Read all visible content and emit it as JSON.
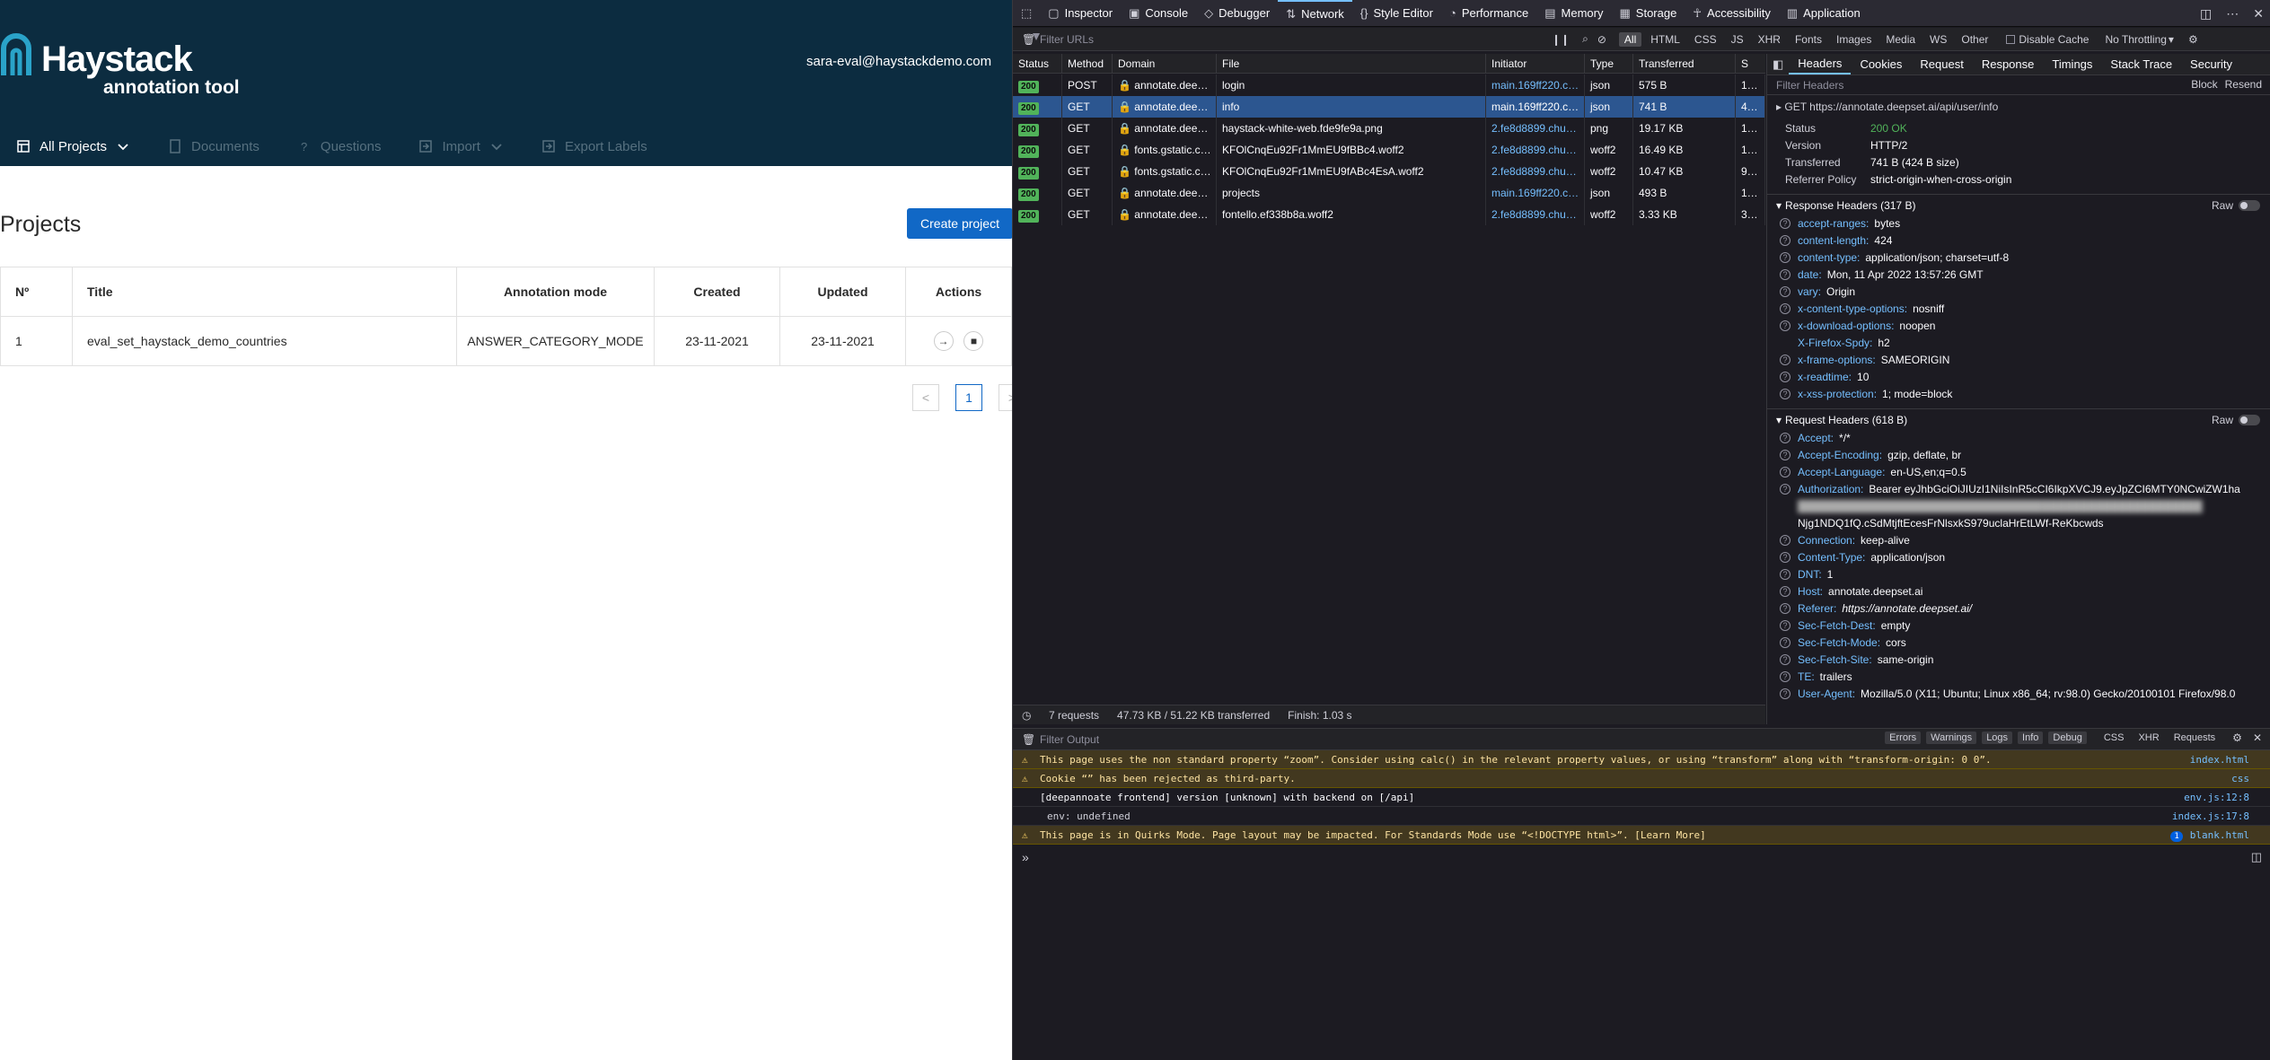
{
  "app": {
    "logo_title": "Haystack",
    "logo_subtitle": "annotation tool",
    "user_email": "sara-eval@haystackdemo.com",
    "nav": {
      "all_projects": "All Projects",
      "documents": "Documents",
      "questions": "Questions",
      "import": "Import",
      "export_labels": "Export Labels"
    },
    "page_title": "Projects",
    "create_button": "Create project",
    "table": {
      "headers": [
        "Nº",
        "Title",
        "Annotation mode",
        "Created",
        "Updated",
        "Actions"
      ],
      "rows": [
        {
          "no": "1",
          "title": "eval_set_haystack_demo_countries",
          "mode": "ANSWER_CATEGORY_MODE",
          "created": "23-11-2021",
          "updated": "23-11-2021"
        }
      ]
    },
    "pagination": {
      "current": "1",
      "prev": "<",
      "next": ">"
    }
  },
  "devtools": {
    "tabs": [
      "Inspector",
      "Console",
      "Debugger",
      "Network",
      "Style Editor",
      "Performance",
      "Memory",
      "Storage",
      "Accessibility",
      "Application"
    ],
    "active_tab": "Network",
    "filter_placeholder": "Filter URLs",
    "type_filters": [
      "All",
      "HTML",
      "CSS",
      "JS",
      "XHR",
      "Fonts",
      "Images",
      "Media",
      "WS",
      "Other"
    ],
    "disable_cache": "Disable Cache",
    "throttling": "No Throttling",
    "columns": [
      "Status",
      "Method",
      "Domain",
      "File",
      "Initiator",
      "Type",
      "Transferred",
      "S"
    ],
    "requests": [
      {
        "status": "200",
        "method": "POST",
        "domain": "annotate.dee…",
        "file": "login",
        "initiator": "main.169ff220.c…",
        "type": "json",
        "transferred": "575 B",
        "size": "1…"
      },
      {
        "status": "200",
        "method": "GET",
        "domain": "annotate.dee…",
        "file": "info",
        "initiator": "main.169ff220.c…",
        "type": "json",
        "transferred": "741 B",
        "size": "4…"
      },
      {
        "status": "200",
        "method": "GET",
        "domain": "annotate.dee…",
        "file": "haystack-white-web.fde9fe9a.png",
        "initiator": "2.fe8d8899.chu…",
        "type": "png",
        "transferred": "19.17 KB",
        "size": "1…"
      },
      {
        "status": "200",
        "method": "GET",
        "domain": "fonts.gstatic.c…",
        "file": "KFOlCnqEu92Fr1MmEU9fBBc4.woff2",
        "initiator": "2.fe8d8899.chu…",
        "type": "woff2",
        "transferred": "16.49 KB",
        "size": "1…"
      },
      {
        "status": "200",
        "method": "GET",
        "domain": "fonts.gstatic.c…",
        "file": "KFOlCnqEu92Fr1MmEU9fABc4EsA.woff2",
        "initiator": "2.fe8d8899.chu…",
        "type": "woff2",
        "transferred": "10.47 KB",
        "size": "9…"
      },
      {
        "status": "200",
        "method": "GET",
        "domain": "annotate.dee…",
        "file": "projects",
        "initiator": "main.169ff220.c…",
        "type": "json",
        "transferred": "493 B",
        "size": "1…"
      },
      {
        "status": "200",
        "method": "GET",
        "domain": "annotate.dee…",
        "file": "fontello.ef338b8a.woff2",
        "initiator": "2.fe8d8899.chu…",
        "type": "woff2",
        "transferred": "3.33 KB",
        "size": "3…"
      }
    ],
    "summary": {
      "requests": "7 requests",
      "size": "47.73 KB / 51.22 KB transferred",
      "finish": "Finish: 1.03 s"
    },
    "side_tabs": [
      "Headers",
      "Cookies",
      "Request",
      "Response",
      "Timings",
      "Stack Trace",
      "Security"
    ],
    "side_filter_placeholder": "Filter Headers",
    "block": "Block",
    "resend": "Resend",
    "request_line": "GET https://annotate.deepset.ai/api/user/info",
    "general": [
      {
        "k": "Status",
        "v": "200 OK"
      },
      {
        "k": "Version",
        "v": "HTTP/2"
      },
      {
        "k": "Transferred",
        "v": "741 B (424 B size)"
      },
      {
        "k": "Referrer Policy",
        "v": "strict-origin-when-cross-origin"
      }
    ],
    "response_headers_title": "Response Headers (317 B)",
    "response_headers": [
      {
        "n": "accept-ranges:",
        "v": "bytes"
      },
      {
        "n": "content-length:",
        "v": "424"
      },
      {
        "n": "content-type:",
        "v": "application/json; charset=utf-8"
      },
      {
        "n": "date:",
        "v": "Mon, 11 Apr 2022 13:57:26 GMT"
      },
      {
        "n": "vary:",
        "v": "Origin"
      },
      {
        "n": "x-content-type-options:",
        "v": "nosniff"
      },
      {
        "n": "x-download-options:",
        "v": "noopen"
      },
      {
        "n": "X-Firefox-Spdy:",
        "v": "h2"
      },
      {
        "n": "x-frame-options:",
        "v": "SAMEORIGIN"
      },
      {
        "n": "x-readtime:",
        "v": "10"
      },
      {
        "n": "x-xss-protection:",
        "v": "1; mode=block"
      }
    ],
    "request_headers_title": "Request Headers (618 B)",
    "raw": "Raw",
    "request_headers": [
      {
        "n": "Accept:",
        "v": "*/*"
      },
      {
        "n": "Accept-Encoding:",
        "v": "gzip, deflate, br"
      },
      {
        "n": "Accept-Language:",
        "v": "en-US,en;q=0.5"
      },
      {
        "n": "Authorization:",
        "v": "Bearer eyJhbGciOiJIUzI1NiIsInR5cCI6IkpXVCJ9.eyJpZCI6MTY0NCwiZW1ha"
      },
      {
        "n": "Connection:",
        "v": "keep-alive"
      },
      {
        "n": "Content-Type:",
        "v": "application/json"
      },
      {
        "n": "DNT:",
        "v": "1"
      },
      {
        "n": "Host:",
        "v": "annotate.deepset.ai"
      },
      {
        "n": "Referer:",
        "v": "https://annotate.deepset.ai/"
      },
      {
        "n": "Sec-Fetch-Dest:",
        "v": "empty"
      },
      {
        "n": "Sec-Fetch-Mode:",
        "v": "cors"
      },
      {
        "n": "Sec-Fetch-Site:",
        "v": "same-origin"
      },
      {
        "n": "TE:",
        "v": "trailers"
      },
      {
        "n": "User-Agent:",
        "v": "Mozilla/5.0 (X11; Ubuntu; Linux x86_64; rv:98.0) Gecko/20100101 Firefox/98.0"
      }
    ],
    "auth_tail": "Njg1NDQ1fQ.cSdMtjftEcesFrNlsxkS979uclaHrEtLWf-ReKbcwds",
    "console": {
      "filter_placeholder": "Filter Output",
      "levels": [
        "Errors",
        "Warnings",
        "Logs",
        "Info",
        "Debug"
      ],
      "categories": [
        "CSS",
        "XHR",
        "Requests"
      ],
      "messages": [
        {
          "level": "warn",
          "text": "This page uses the non standard property “zoom”. Consider using calc() in the relevant property values, or using “transform” along with “transform-origin: 0 0”.",
          "src": "index.html"
        },
        {
          "level": "warn",
          "text": "Cookie “” has been rejected as third-party.",
          "src": "css"
        },
        {
          "level": "log",
          "text": "[deepannoate frontend] version [unknown] with backend on [/api]",
          "src": "env.js:12:8"
        },
        {
          "level": "log",
          "text": "env:  undefined",
          "src": "index.js:17:8"
        },
        {
          "level": "warn",
          "text": "This page is in Quirks Mode. Page layout may be impacted. For Standards Mode use “<!DOCTYPE html>”. [Learn More]",
          "src": "blank.html",
          "badge": "1"
        }
      ]
    }
  }
}
